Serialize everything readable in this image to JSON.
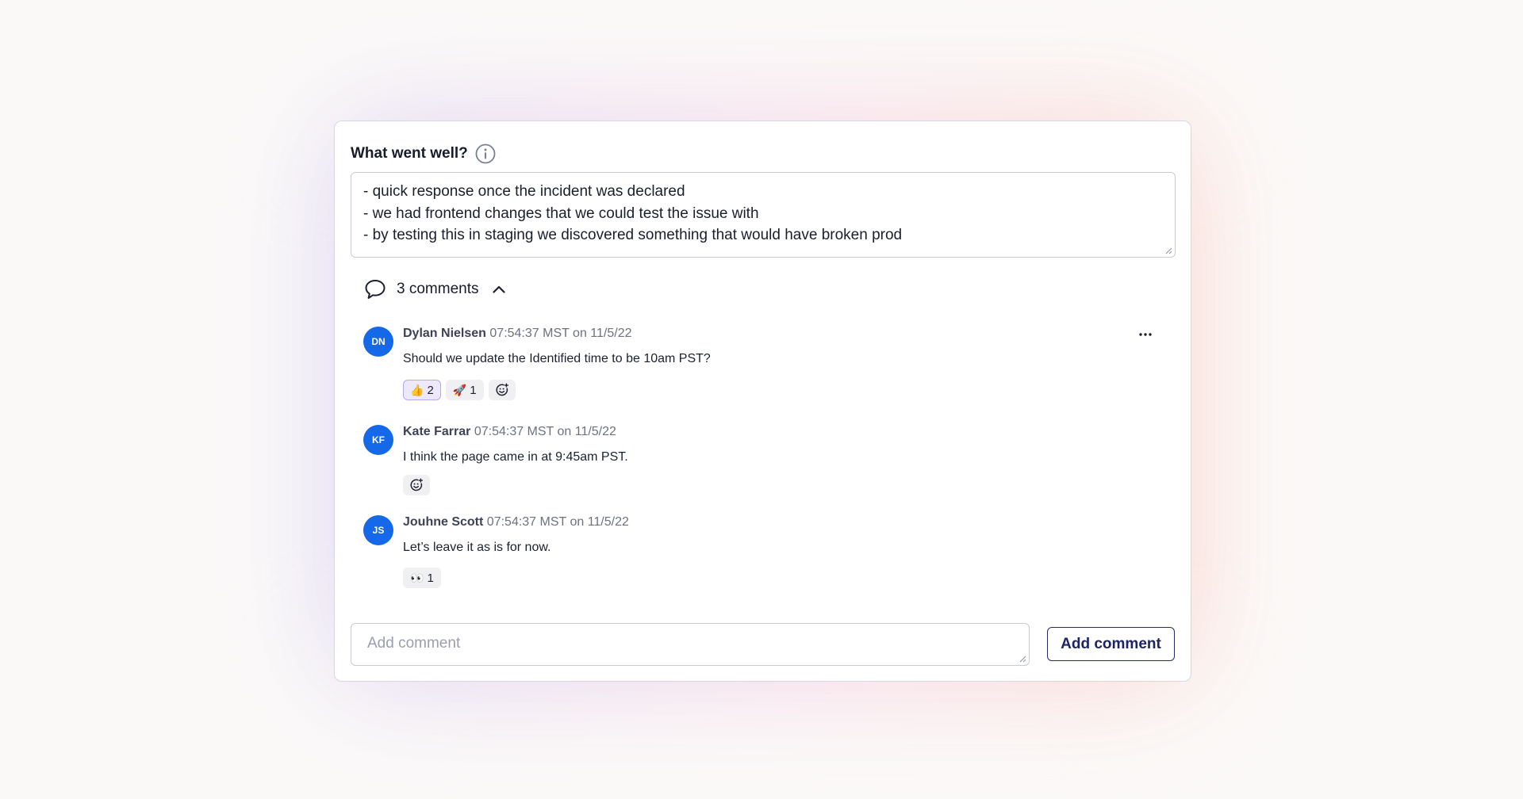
{
  "section": {
    "title": "What went well?",
    "info_icon": "info-circle-icon",
    "answer_lines": [
      "- quick response once the incident was declared",
      "- we had frontend changes that we could test the issue with",
      "- by testing this in staging we discovered something that would have broken prod"
    ]
  },
  "comments_toggle": {
    "label": "3 comments",
    "icon": "speech-bubble-icon",
    "state_icon": "chevron-up-icon"
  },
  "comments": [
    {
      "initials": "DN",
      "author": "Dylan Nielsen",
      "timestamp": "07:54:37 MST on 11/5/22",
      "text": "Should we update the Identified time to be 10am PST?",
      "reactions": [
        {
          "emoji": "👍",
          "count": "2",
          "active": true
        },
        {
          "emoji": "🚀",
          "count": "1",
          "active": false
        }
      ]
    },
    {
      "initials": "KF",
      "author": "Kate Farrar",
      "timestamp": "07:54:37 MST on 11/5/22",
      "text": "I think the page came in at 9:45am PST.",
      "reactions": []
    },
    {
      "initials": "JS",
      "author": "Jouhne Scott",
      "timestamp": "07:54:37 MST on 11/5/22",
      "text": "Let’s leave it as is for now.",
      "reactions": [
        {
          "emoji": "👀",
          "count": "1",
          "active": false
        }
      ]
    }
  ],
  "new_comment": {
    "placeholder": "Add comment",
    "button_label": "Add comment"
  },
  "colors": {
    "avatar": "#1568e8",
    "reaction_active_bg": "#ede8fb",
    "reaction_active_border": "#b8a9ee",
    "button_border": "#262a6a"
  }
}
